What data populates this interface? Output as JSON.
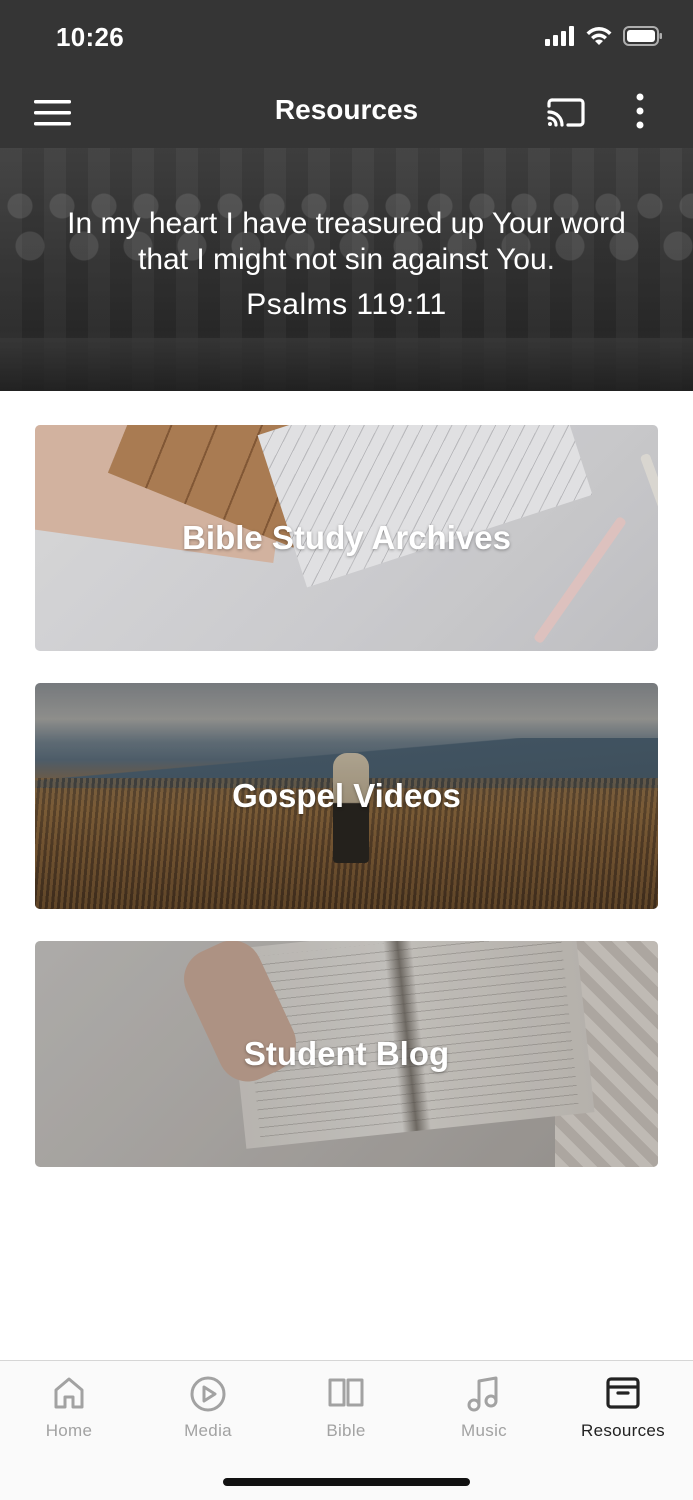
{
  "status_bar": {
    "time": "10:26",
    "icons": [
      "cellular-signal-icon",
      "wifi-icon",
      "battery-icon"
    ]
  },
  "app_bar": {
    "title": "Resources",
    "left_icon": "hamburger-menu-icon",
    "right_icons": [
      "cast-icon",
      "more-vertical-icon"
    ]
  },
  "hero": {
    "verse_line_1": "In my heart I have treasured up Your word",
    "verse_line_2": "that I might not sin against You.",
    "reference": "Psalms 119:11"
  },
  "resources": [
    {
      "label": "Bible Study Archives"
    },
    {
      "label": "Gospel Videos"
    },
    {
      "label": "Student Blog"
    }
  ],
  "tabs": [
    {
      "label": "Home",
      "icon": "home-icon",
      "active": false
    },
    {
      "label": "Media",
      "icon": "play-circle-icon",
      "active": false
    },
    {
      "label": "Bible",
      "icon": "open-book-icon",
      "active": false
    },
    {
      "label": "Music",
      "icon": "music-note-icon",
      "active": false
    },
    {
      "label": "Resources",
      "icon": "archive-box-icon",
      "active": true
    }
  ],
  "colors": {
    "app_bar_bg": "#353535",
    "tab_active": "#222222",
    "tab_inactive": "#a2a2a2",
    "background": "#ffffff"
  }
}
